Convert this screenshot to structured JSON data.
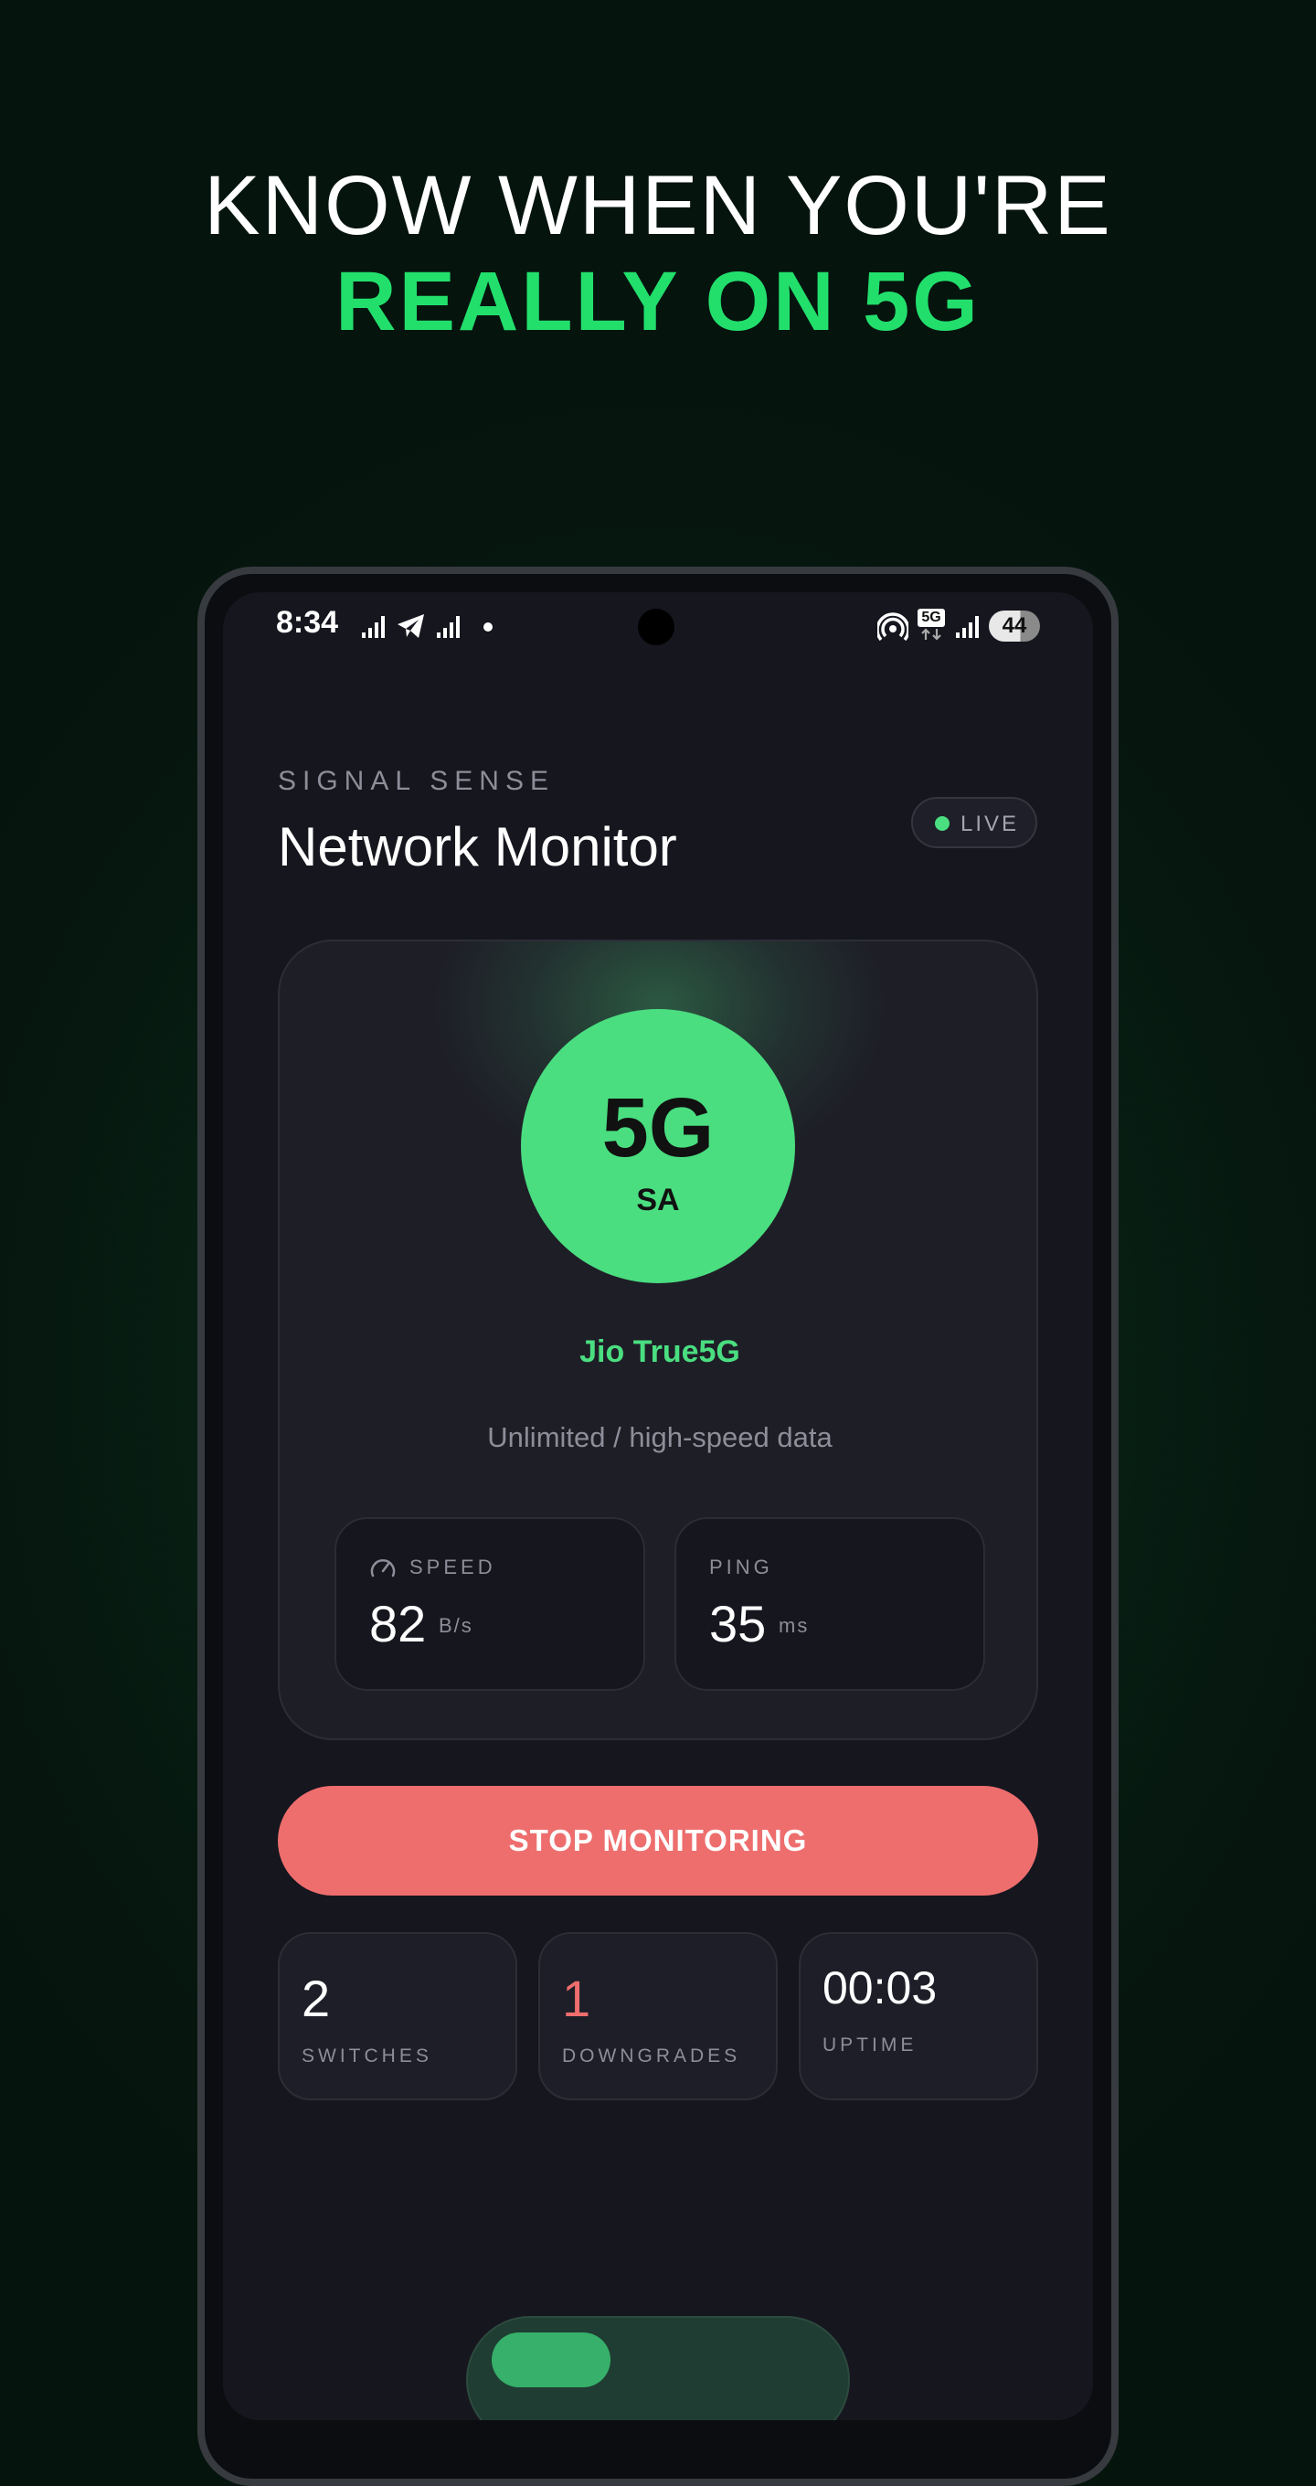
{
  "headline": {
    "line1": "KNOW WHEN YOU'RE",
    "line2": "REALLY ON 5G"
  },
  "status_bar": {
    "time": "8:34",
    "network_badge": "5G",
    "battery": "44"
  },
  "app": {
    "kicker": "SIGNAL SENSE",
    "title": "Network Monitor",
    "live_badge": "LIVE"
  },
  "network": {
    "type": "5G",
    "mode": "SA",
    "carrier": "Jio True5G",
    "plan": "Unlimited / high-speed data"
  },
  "metrics": {
    "speed": {
      "label": "SPEED",
      "value": "82",
      "unit": "B/s"
    },
    "ping": {
      "label": "PING",
      "value": "35",
      "unit": "ms"
    }
  },
  "action": {
    "stop_label": "STOP MONITORING"
  },
  "stats": [
    {
      "value": "2",
      "label": "SWITCHES"
    },
    {
      "value": "1",
      "label": "DOWNGRADES"
    },
    {
      "value": "00:03",
      "label": "UPTIME"
    }
  ],
  "colors": {
    "accent_green": "#4ade80",
    "headline_green": "#22df6c",
    "stop_red": "#ee6e6e",
    "downgrade_red": "#ee6e6e",
    "card_bg": "#1e1e27",
    "screen_bg": "#16161f"
  }
}
